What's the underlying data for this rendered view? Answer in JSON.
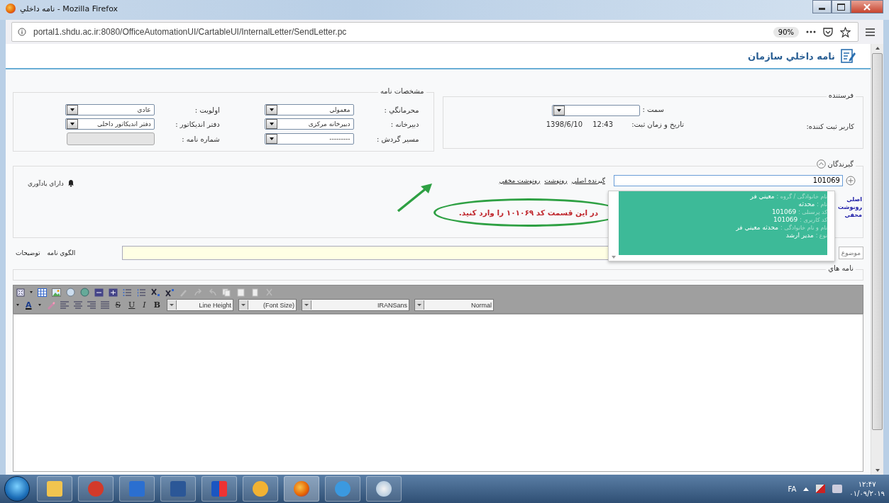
{
  "window": {
    "title": "نامه داخلي - Mozilla Firefox"
  },
  "browser": {
    "url": "portal1.shdu.ac.ir:8080/OfficeAutomationUI/CartableUI/InternalLetter/SendLetter.pc",
    "zoom": "90%"
  },
  "page": {
    "title": "نامه داخلي سازمان"
  },
  "sender": {
    "legend": "فرستنده",
    "position_label": "سمت :",
    "registrar_label": "کاربر ثبت کننده:",
    "datetime_label": "تاريخ و زمان ثبت:",
    "time": "12:43",
    "date": "1398/6/10"
  },
  "details": {
    "legend": "مشخصات نامه",
    "fields": [
      {
        "label": "محرمانگي :",
        "value": "معمولي",
        "kind": "select"
      },
      {
        "label": "اولويت :",
        "value": "عادي",
        "kind": "select"
      },
      {
        "label": "دبيرخانه :",
        "value": "دبيرخانه مرکزی",
        "kind": "select"
      },
      {
        "label": "دفتر انديکاتور :",
        "value": "دفتر انديکاتور داخلی",
        "kind": "select"
      },
      {
        "label": "مسير گردش :",
        "value": "---------",
        "kind": "select"
      },
      {
        "label": "شماره نامه :",
        "kind": "readonly"
      }
    ]
  },
  "recipients": {
    "legend": "گيرندگان",
    "search_value": "101069",
    "links": [
      "گيرنده اصلي",
      "رونوشت",
      "رونوشت مخفي"
    ],
    "reminder": "داراي يادآوري",
    "side_labels": [
      "اصلي",
      "رونوشت",
      "مخفي"
    ]
  },
  "suggestion": {
    "lines": [
      {
        "label": "نام خانوادگی / گروه :",
        "value": "معيني فر"
      },
      {
        "label": "نام :",
        "value": "محدثه"
      },
      {
        "label": "کد پرسنلی :",
        "value": "101069"
      },
      {
        "label": "کد کاربری :",
        "value": "101069"
      },
      {
        "label": "نام و نام خانوادگی :",
        "value": "محدثه معيني فر"
      },
      {
        "label": "نوع :",
        "value": "مدير ارشد"
      }
    ]
  },
  "annotation": {
    "text": "در اين قسمت کد ۱۰۱۰۶۹ را وارد کنيد."
  },
  "subject": {
    "label": "موضوع",
    "links": [
      "الگوي نامه",
      "توضيحات"
    ]
  },
  "attachments": {
    "label": "نامه هاي"
  },
  "editor": {
    "selects": [
      "Normal",
      "IRANSans",
      "(Font Size)",
      "Line Height"
    ],
    "format_buttons": [
      {
        "glyph": "B",
        "kind": "bold"
      },
      {
        "glyph": "I",
        "kind": "italic"
      },
      {
        "glyph": "U",
        "kind": "underline"
      },
      {
        "glyph": "S",
        "kind": "strike"
      },
      {
        "glyph": "A",
        "kind": "color"
      }
    ]
  },
  "taskbar": {
    "language": "FA",
    "time": "۱۲:۴۷",
    "date": "۰۱/۰۹/۲۰۱۹"
  }
}
